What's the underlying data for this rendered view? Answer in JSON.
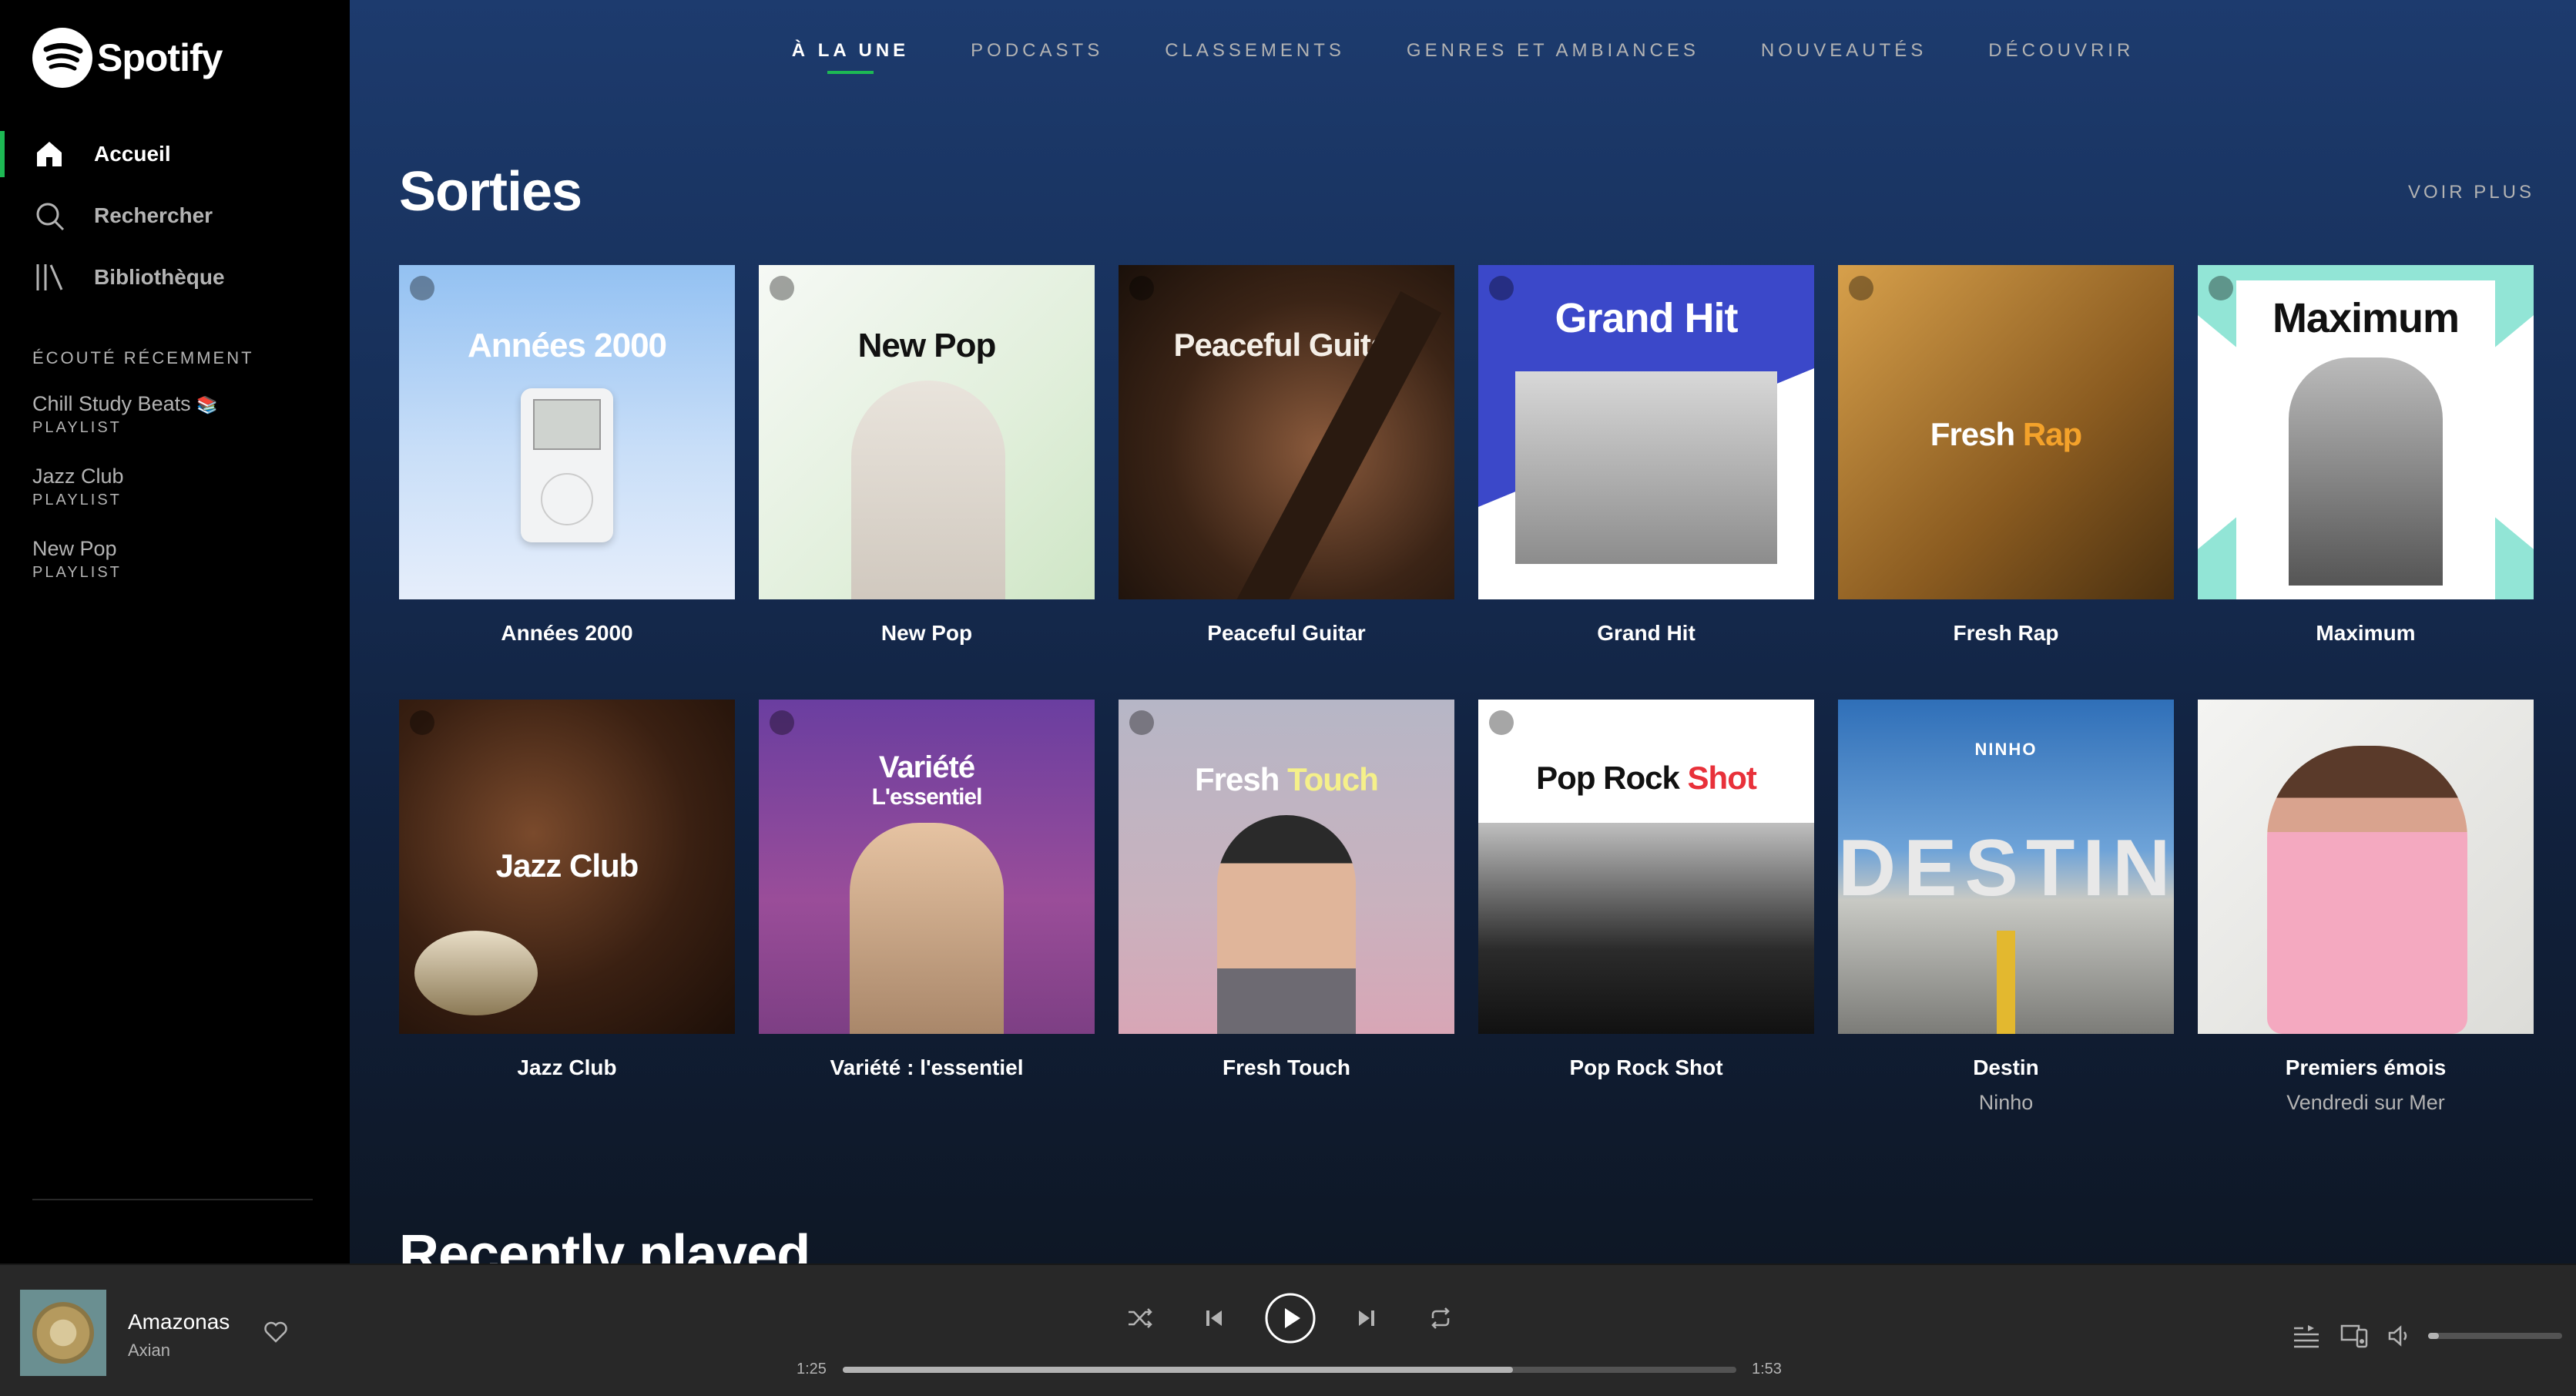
{
  "app": {
    "name": "Spotify"
  },
  "sidebar": {
    "nav": [
      {
        "label": "Accueil",
        "icon": "home-icon",
        "active": true
      },
      {
        "label": "Rechercher",
        "icon": "search-icon",
        "active": false
      },
      {
        "label": "Bibliothèque",
        "icon": "library-icon",
        "active": false
      }
    ],
    "recent_title": "ÉCOUTÉ RÉCEMMENT",
    "recent": [
      {
        "name": "Chill Study Beats",
        "emoji": "📚",
        "type": "PLAYLIST"
      },
      {
        "name": "Jazz Club",
        "type": "PLAYLIST"
      },
      {
        "name": "New Pop",
        "type": "PLAYLIST"
      }
    ]
  },
  "tabs": [
    {
      "label": "À LA UNE",
      "active": true
    },
    {
      "label": "PODCASTS"
    },
    {
      "label": "CLASSEMENTS"
    },
    {
      "label": "GENRES ET AMBIANCES"
    },
    {
      "label": "NOUVEAUTÉS"
    },
    {
      "label": "DÉCOUVRIR"
    }
  ],
  "section": {
    "title": "Sorties",
    "see_more": "VOIR PLUS",
    "cards": [
      {
        "title": "Années 2000",
        "cover_text": "Années 2000",
        "style": "annees"
      },
      {
        "title": "New Pop",
        "cover_text": "New Pop",
        "style": "newpop"
      },
      {
        "title": "Peaceful Guitar",
        "cover_text": "Peaceful Guitar",
        "style": "guitar"
      },
      {
        "title": "Grand Hit",
        "cover_text": "Grand Hit",
        "style": "grandhit"
      },
      {
        "title": "Fresh Rap",
        "cover_text_a": "Fresh",
        "cover_text_b": "Rap",
        "style": "freshrap"
      },
      {
        "title": "Maximum",
        "cover_text": "Maximum",
        "style": "maximum"
      },
      {
        "title": "Jazz Club",
        "cover_text": "Jazz Club",
        "style": "jazz"
      },
      {
        "title": "Variété : l'essentiel",
        "cover_text": "Variété",
        "cover_text_b": "L'essentiel",
        "style": "variete"
      },
      {
        "title": "Fresh Touch",
        "cover_text_a": "Fresh",
        "cover_text_b": "Touch",
        "style": "freshtouch"
      },
      {
        "title": "Pop Rock Shot",
        "cover_text_a": "Pop Rock",
        "cover_text_b": "Shot",
        "style": "poprock"
      },
      {
        "title": "Destin",
        "subtitle": "Ninho",
        "cover_text": "DESTIN",
        "cover_logo": "NINHO",
        "style": "destin"
      },
      {
        "title": "Premiers émois",
        "subtitle": "Vendredi sur Mer",
        "style": "premiers"
      }
    ]
  },
  "next_section": {
    "title": "Recently played"
  },
  "player": {
    "track": "Amazonas",
    "artist": "Axian",
    "elapsed": "1:25",
    "duration": "1:53",
    "progress_fraction": 0.75,
    "volume_fraction": 0.08
  },
  "colors": {
    "accent": "#1db954",
    "sidebar": "#000000",
    "player": "#282828"
  }
}
